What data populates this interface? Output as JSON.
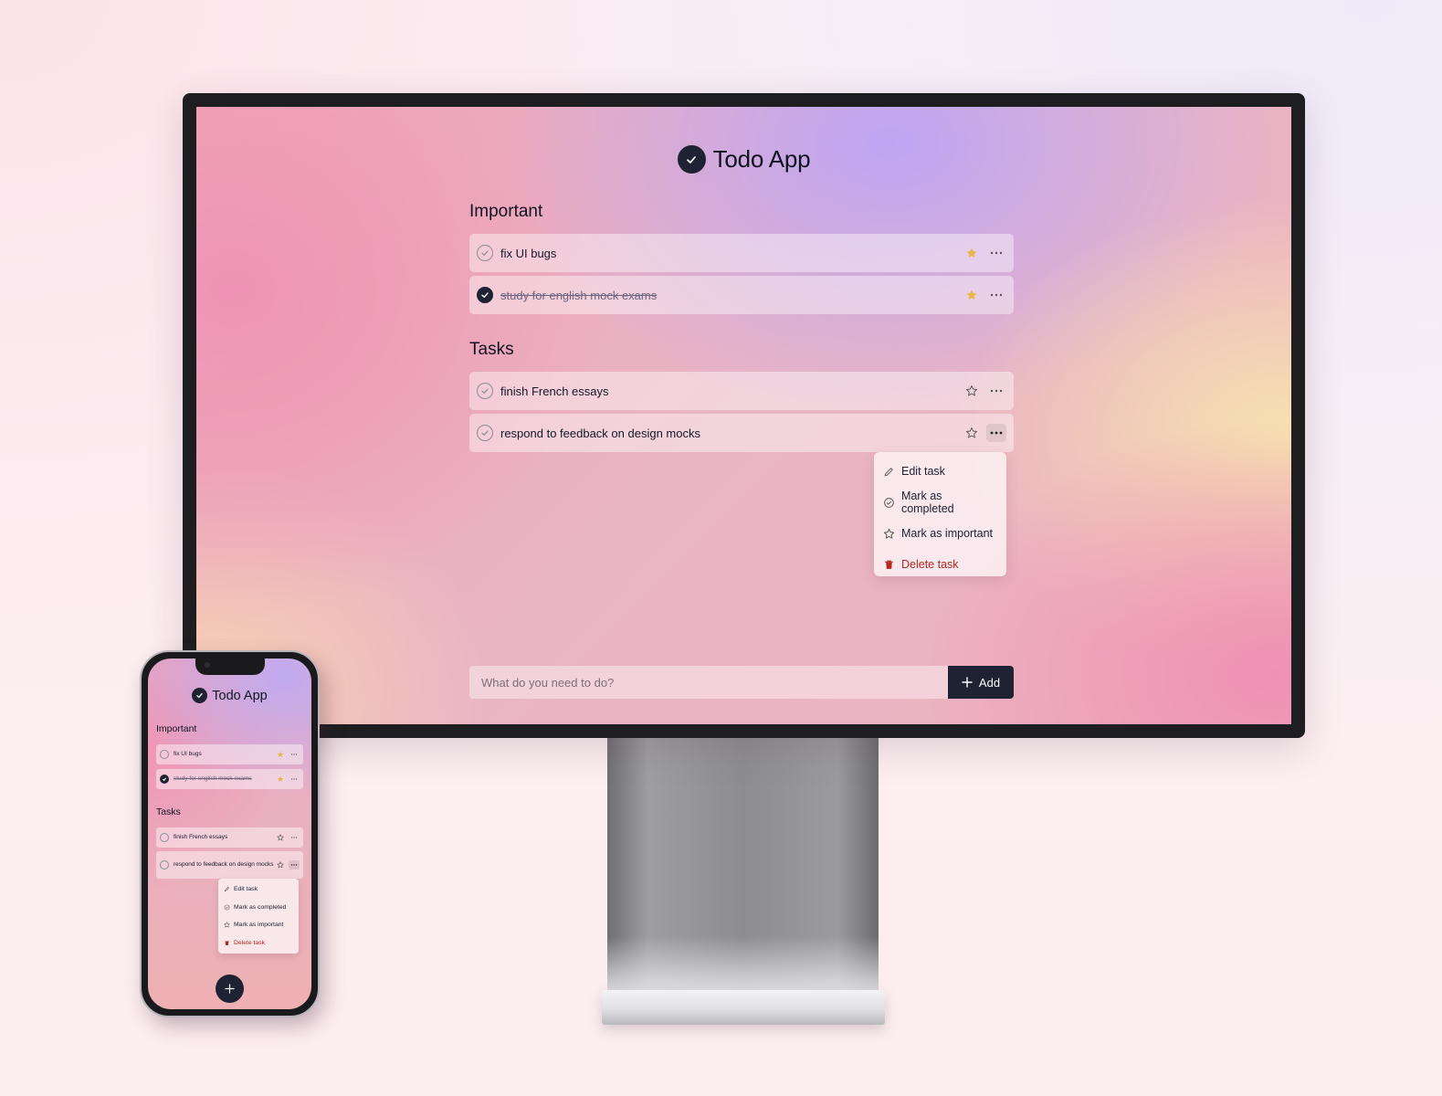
{
  "app": {
    "title": "Todo App",
    "accent_color": "#1f2233",
    "star_color": "#e8b54a",
    "danger_color": "#b3261e"
  },
  "sections": {
    "important": {
      "title": "Important"
    },
    "tasks": {
      "title": "Tasks"
    }
  },
  "important_tasks": [
    {
      "text": "fix UI bugs",
      "completed": false,
      "starred": true
    },
    {
      "text": "study for english mock exams",
      "completed": true,
      "starred": true
    }
  ],
  "tasks": [
    {
      "text": "finish French essays",
      "completed": false,
      "starred": false
    },
    {
      "text": "respond to feedback on design mocks",
      "completed": false,
      "starred": false,
      "menu_open": true
    }
  ],
  "context_menu": {
    "items": [
      {
        "label": "Edit task",
        "icon": "pencil-icon"
      },
      {
        "label": "Mark as completed",
        "icon": "check-circle-icon"
      },
      {
        "label": "Mark as important",
        "icon": "star-outline-icon"
      },
      {
        "label": "Delete task",
        "icon": "trash-icon",
        "danger": true
      }
    ]
  },
  "composer": {
    "placeholder": "What do you need to do?",
    "add_label": "Add"
  },
  "mobile": {
    "title": "Todo App",
    "fab_icon": "plus-icon"
  }
}
